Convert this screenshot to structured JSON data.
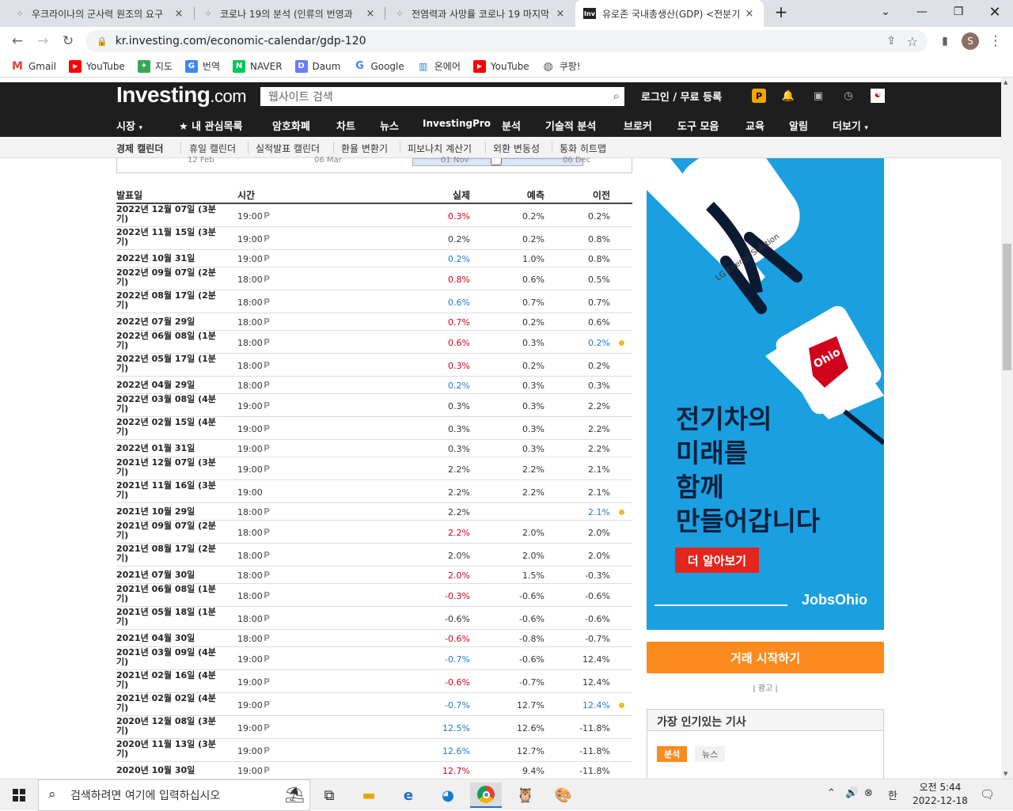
{
  "browser": {
    "tabs": [
      {
        "title": "우크라이나의 군사력 원조의 요구",
        "close": "×"
      },
      {
        "title": "코로나 19의 분석 (인류의 번영과",
        "close": "×"
      },
      {
        "title": "전염력과 사망률 코로나 19 마지막",
        "close": "×"
      },
      {
        "title": "유로존 국내총생산(GDP) <전분기",
        "close": "×",
        "favicon": "Inv"
      }
    ],
    "new_tab": "+",
    "url": "kr.investing.com/economic-calendar/gdp-120",
    "profile_initial": "S",
    "bookmarks": [
      "Gmail",
      "YouTube",
      "지도",
      "번역",
      "NAVER",
      "Daum",
      "Google",
      "온에어",
      "YouTube",
      "쿠팡!"
    ]
  },
  "site": {
    "logo_main": "Investing",
    "logo_suffix": ".com",
    "search_placeholder": "웹사이트 검색",
    "login": "로그인 / 무료 등록",
    "main_nav": [
      "시장",
      "★ 내 관심목록",
      "암호화폐",
      "차트",
      "뉴스",
      "InvestingPro",
      "분석",
      "기술적 분석",
      "브로커",
      "도구 모음",
      "교육",
      "알림",
      "더보기"
    ],
    "sub_nav": [
      "경제 캘린더",
      "휴일 캘린더",
      "실적발표 캘린더",
      "환율 변환기",
      "피보나치 계산기",
      "외환 변동성",
      "통화 히트맵"
    ],
    "chart_axis_labels": [
      "12 Feb",
      "06 Mar",
      "01 Nov",
      "06 Dec"
    ]
  },
  "table": {
    "headers": {
      "date": "발표일",
      "time": "시간",
      "actual": "실제",
      "forecast": "예측",
      "previous": "이전"
    },
    "rows": [
      {
        "date": "2022년 12월 07일 (3분기)",
        "time": "19:00",
        "pre": "P",
        "actual": "0.3%",
        "forecast": "0.2%",
        "previous": "0.2%",
        "ac": "red",
        "pc": "blk"
      },
      {
        "date": "2022년 11월 15일 (3분기)",
        "time": "19:00",
        "pre": "P",
        "actual": "0.2%",
        "forecast": "0.2%",
        "previous": "0.8%",
        "ac": "blk",
        "pc": "blk"
      },
      {
        "date": "2022년 10월 31일",
        "time": "19:00",
        "pre": "P",
        "actual": "0.2%",
        "forecast": "1.0%",
        "previous": "0.8%",
        "ac": "blue",
        "pc": "blk"
      },
      {
        "date": "2022년 09월 07일 (2분기)",
        "time": "18:00",
        "pre": "P",
        "actual": "0.8%",
        "forecast": "0.6%",
        "previous": "0.5%",
        "ac": "red",
        "pc": "blk"
      },
      {
        "date": "2022년 08월 17일 (2분기)",
        "time": "18:00",
        "pre": "P",
        "actual": "0.6%",
        "forecast": "0.7%",
        "previous": "0.7%",
        "ac": "blue",
        "pc": "blk"
      },
      {
        "date": "2022년 07월 29일",
        "time": "18:00",
        "pre": "P",
        "actual": "0.7%",
        "forecast": "0.2%",
        "previous": "0.6%",
        "ac": "red",
        "pc": "blk"
      },
      {
        "date": "2022년 06월 08일 (1분기)",
        "time": "18:00",
        "pre": "P",
        "actual": "0.6%",
        "forecast": "0.3%",
        "previous": "0.2%",
        "ac": "red",
        "pc": "blue",
        "dot": true
      },
      {
        "date": "2022년 05월 17일 (1분기)",
        "time": "18:00",
        "pre": "P",
        "actual": "0.3%",
        "forecast": "0.2%",
        "previous": "0.2%",
        "ac": "red",
        "pc": "blk"
      },
      {
        "date": "2022년 04월 29일",
        "time": "18:00",
        "pre": "P",
        "actual": "0.2%",
        "forecast": "0.3%",
        "previous": "0.3%",
        "ac": "blue",
        "pc": "blk"
      },
      {
        "date": "2022년 03월 08일 (4분기)",
        "time": "19:00",
        "pre": "P",
        "actual": "0.3%",
        "forecast": "0.3%",
        "previous": "2.2%",
        "ac": "blk",
        "pc": "blk"
      },
      {
        "date": "2022년 02월 15일 (4분기)",
        "time": "19:00",
        "pre": "P",
        "actual": "0.3%",
        "forecast": "0.3%",
        "previous": "2.2%",
        "ac": "blk",
        "pc": "blk"
      },
      {
        "date": "2022년 01월 31일",
        "time": "19:00",
        "pre": "P",
        "actual": "0.3%",
        "forecast": "0.3%",
        "previous": "2.2%",
        "ac": "blk",
        "pc": "blk"
      },
      {
        "date": "2021년 12월 07일 (3분기)",
        "time": "19:00",
        "pre": "P",
        "actual": "2.2%",
        "forecast": "2.2%",
        "previous": "2.1%",
        "ac": "blk",
        "pc": "blk"
      },
      {
        "date": "2021년 11월 16일 (3분기)",
        "time": "19:00",
        "pre": "",
        "actual": "2.2%",
        "forecast": "2.2%",
        "previous": "2.1%",
        "ac": "blk",
        "pc": "blk"
      },
      {
        "date": "2021년 10월 29일",
        "time": "18:00",
        "pre": "P",
        "actual": "2.2%",
        "forecast": "",
        "previous": "2.1%",
        "ac": "blk",
        "pc": "blue",
        "dot": true
      },
      {
        "date": "2021년 09월 07일 (2분기)",
        "time": "18:00",
        "pre": "P",
        "actual": "2.2%",
        "forecast": "2.0%",
        "previous": "2.0%",
        "ac": "red",
        "pc": "blk"
      },
      {
        "date": "2021년 08월 17일 (2분기)",
        "time": "18:00",
        "pre": "P",
        "actual": "2.0%",
        "forecast": "2.0%",
        "previous": "2.0%",
        "ac": "blk",
        "pc": "blk"
      },
      {
        "date": "2021년 07월 30일",
        "time": "18:00",
        "pre": "P",
        "actual": "2.0%",
        "forecast": "1.5%",
        "previous": "-0.3%",
        "ac": "red",
        "pc": "blk"
      },
      {
        "date": "2021년 06월 08일 (1분기)",
        "time": "18:00",
        "pre": "P",
        "actual": "-0.3%",
        "forecast": "-0.6%",
        "previous": "-0.6%",
        "ac": "red",
        "pc": "blk"
      },
      {
        "date": "2021년 05월 18일 (1분기)",
        "time": "18:00",
        "pre": "P",
        "actual": "-0.6%",
        "forecast": "-0.6%",
        "previous": "-0.6%",
        "ac": "blk",
        "pc": "blk"
      },
      {
        "date": "2021년 04월 30일",
        "time": "18:00",
        "pre": "P",
        "actual": "-0.6%",
        "forecast": "-0.8%",
        "previous": "-0.7%",
        "ac": "red",
        "pc": "blk"
      },
      {
        "date": "2021년 03월 09일 (4분기)",
        "time": "19:00",
        "pre": "P",
        "actual": "-0.7%",
        "forecast": "-0.6%",
        "previous": "12.4%",
        "ac": "blue",
        "pc": "blk"
      },
      {
        "date": "2021년 02월 16일 (4분기)",
        "time": "19:00",
        "pre": "P",
        "actual": "-0.6%",
        "forecast": "-0.7%",
        "previous": "12.4%",
        "ac": "red",
        "pc": "blk"
      },
      {
        "date": "2021년 02월 02일 (4분기)",
        "time": "19:00",
        "pre": "P",
        "actual": "-0.7%",
        "forecast": "12.7%",
        "previous": "12.4%",
        "ac": "blue",
        "pc": "blue",
        "dot": true
      },
      {
        "date": "2020년 12월 08일 (3분기)",
        "time": "19:00",
        "pre": "P",
        "actual": "12.5%",
        "forecast": "12.6%",
        "previous": "-11.8%",
        "ac": "blue",
        "pc": "blk"
      },
      {
        "date": "2020년 11월 13일 (3분기)",
        "time": "19:00",
        "pre": "P",
        "actual": "12.6%",
        "forecast": "12.7%",
        "previous": "-11.8%",
        "ac": "blue",
        "pc": "blk"
      },
      {
        "date": "2020년 10월 30일",
        "time": "19:00",
        "pre": "P",
        "actual": "12.7%",
        "forecast": "9.4%",
        "previous": "-11.8%",
        "ac": "red",
        "pc": "blk"
      }
    ]
  },
  "ad": {
    "sponsor": "LG Energy Solution",
    "state": "Ohio",
    "headline_lines": [
      "전기차의",
      "미래를",
      "함께",
      "만들어갑니다"
    ],
    "cta": "더 알아보기",
    "brand": "JobsOhio",
    "bg_color": "#1aa0e0"
  },
  "sidebar": {
    "trade_button": "거래 시작하기",
    "ad_label": "| 광고 |",
    "popular_title": "가장 인기있는 기사",
    "popular_tabs": [
      "분석",
      "뉴스"
    ]
  },
  "taskbar": {
    "search_placeholder": "검색하려면 여기에 입력하십시오",
    "ime": "한",
    "time": "오전 5:44",
    "date": "2022-12-18"
  }
}
